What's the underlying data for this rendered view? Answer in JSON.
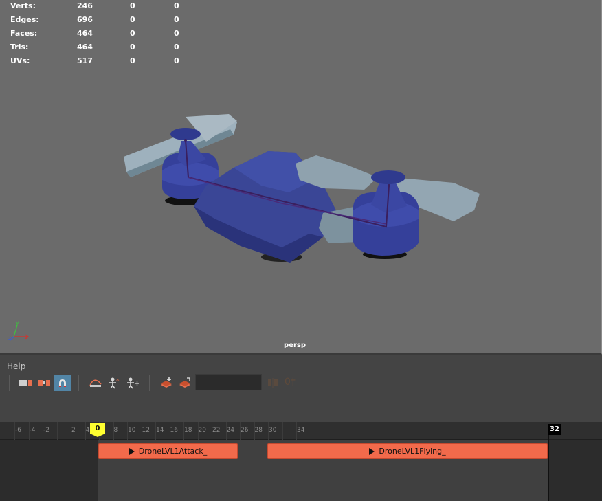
{
  "hud": {
    "rows": [
      {
        "label": "Verts:",
        "v1": "246",
        "v2": "0",
        "v3": "0"
      },
      {
        "label": "Edges:",
        "v1": "696",
        "v2": "0",
        "v3": "0"
      },
      {
        "label": "Faces:",
        "v1": "464",
        "v2": "0",
        "v3": "0"
      },
      {
        "label": "Tris:",
        "v1": "464",
        "v2": "0",
        "v3": "0"
      },
      {
        "label": "UVs:",
        "v1": "517",
        "v2": "0",
        "v3": "0"
      }
    ]
  },
  "viewport": {
    "camera_label": "persp",
    "axis_y_label": "y",
    "axis_z_label": "z",
    "colors": {
      "background": "#6b6b6b",
      "mesh_body": "#3a4696",
      "mesh_blades": "#8fa2ae",
      "rig": "#3a1f5e"
    }
  },
  "menu": {
    "help_label": "Help"
  },
  "toolbar": {
    "icons": [
      "clip-trim-icon",
      "clip-split-icon",
      "magnet-snap-icon",
      "graph-curve-icon",
      "character-add-icon",
      "character-move-icon",
      "layer-add-icon",
      "layer-create-icon",
      "dim-marker-icon"
    ],
    "clip_field_value": "",
    "dim_text": "0†",
    "accent": "#5285a6"
  },
  "timeline": {
    "ticks": [
      "-6",
      "-4",
      "-2",
      "0",
      "2",
      "4",
      "6",
      "8",
      "10",
      "12",
      "14",
      "16",
      "18",
      "20",
      "22",
      "24",
      "26",
      "28",
      "30",
      "32",
      "34"
    ],
    "current_frame": "0",
    "end_frame": "32",
    "clips": [
      {
        "label": "DroneLVL1Attack_"
      },
      {
        "label": "DroneLVL1Flying_"
      }
    ],
    "clip_color": "#f26a4b"
  }
}
